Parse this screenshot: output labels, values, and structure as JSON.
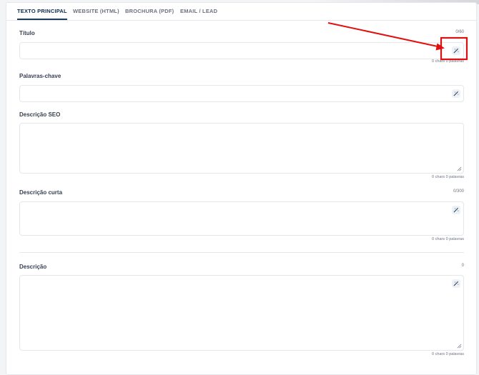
{
  "tabs": [
    {
      "label": "TEXTO PRINCIPAL",
      "active": true
    },
    {
      "label": "WEBSITE (HTML)",
      "active": false
    },
    {
      "label": "BROCHURA (PDF)",
      "active": false
    },
    {
      "label": "EMAIL / LEAD",
      "active": false
    }
  ],
  "titulo": {
    "label": "Título",
    "counter": "0/60",
    "value": "",
    "stats": "0 chars 0 palavras"
  },
  "palavras_chave": {
    "label": "Palavras-chave",
    "value": ""
  },
  "descricao_seo": {
    "label": "Descrição SEO",
    "value": "",
    "stats": "0 chars 0 palavras"
  },
  "descricao_curta": {
    "label": "Descrição curta",
    "counter": "0/300",
    "value": "",
    "stats": "0 chars 0 palavras"
  },
  "descricao": {
    "label": "Descrição",
    "counter": "0",
    "value": "",
    "stats": "0 chars 0 palavras"
  },
  "icons": {
    "ai_generate": "magic-wand-icon",
    "resize": "resize-handle-icon"
  },
  "colors": {
    "active_tab": "#1e3a5f",
    "annotation": "#e01010",
    "icon_bg": "#eef2f7"
  }
}
